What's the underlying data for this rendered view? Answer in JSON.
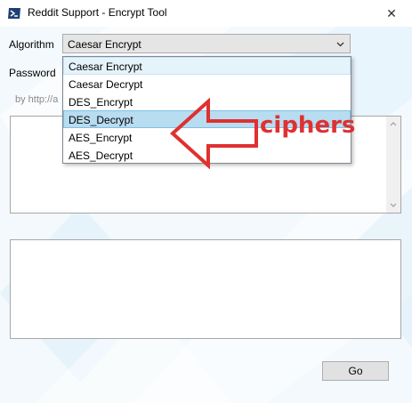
{
  "window": {
    "title": "Reddit Support - Encrypt Tool",
    "close_symbol": "✕"
  },
  "form": {
    "algorithm_label": "Algorithm",
    "password_label": "Password",
    "hint_text": "by http://a",
    "selected_algorithm": "Caesar Encrypt",
    "options": [
      "Caesar Encrypt",
      "Caesar Decrypt",
      "DES_Encrypt",
      "DES_Decrypt",
      "AES_Encrypt",
      "AES_Decrypt"
    ],
    "go_label": "Go"
  },
  "annotation": {
    "text": "ciphers",
    "color": "#e03030"
  },
  "colors": {
    "highlight": "#b8dcf0",
    "hover": "#e5f3fb"
  }
}
